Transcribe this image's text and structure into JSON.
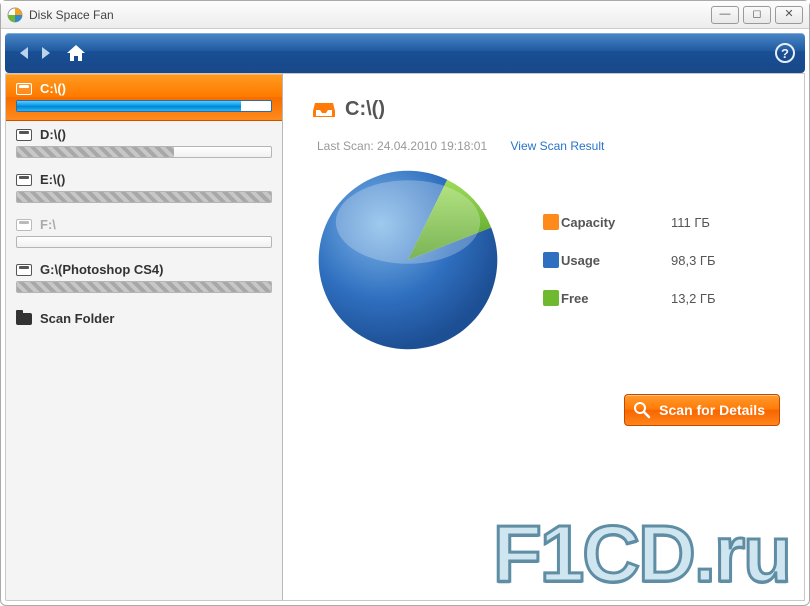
{
  "window": {
    "title": "Disk Space Fan"
  },
  "sidebar": {
    "drives": [
      {
        "label": "C:\\()",
        "usage_pct": 88,
        "selected": true,
        "dim": false
      },
      {
        "label": "D:\\()",
        "usage_pct": 62,
        "selected": false,
        "dim": false
      },
      {
        "label": "E:\\()",
        "usage_pct": 100,
        "selected": false,
        "dim": false
      },
      {
        "label": "F:\\",
        "usage_pct": 0,
        "selected": false,
        "dim": true
      },
      {
        "label": "G:\\(Photoshop CS4)",
        "usage_pct": 100,
        "selected": false,
        "dim": false
      }
    ],
    "scan_folder_label": "Scan Folder"
  },
  "content": {
    "title": "C:\\()",
    "last_scan_label": "Last Scan:",
    "last_scan_value": "24.04.2010 19:18:01",
    "view_result_label": "View Scan Result",
    "legend": {
      "capacity_label": "Capacity",
      "usage_label": "Usage",
      "free_label": "Free",
      "capacity_value": "111 ГБ",
      "usage_value": "98,3 ГБ",
      "free_value": "13,2 ГБ",
      "capacity_color": "#ff8a1c",
      "usage_color": "#2f6fbf",
      "free_color": "#6fb92e"
    },
    "scan_button_label": "Scan for Details"
  },
  "watermark": "F1CD.ru",
  "chart_data": {
    "type": "pie",
    "title": "C:\\() disk usage",
    "unit": "ГБ",
    "total": 111,
    "series": [
      {
        "name": "Usage",
        "value": 98.3,
        "color": "#2f6fbf"
      },
      {
        "name": "Free",
        "value": 13.2,
        "color": "#6fb92e"
      }
    ]
  }
}
